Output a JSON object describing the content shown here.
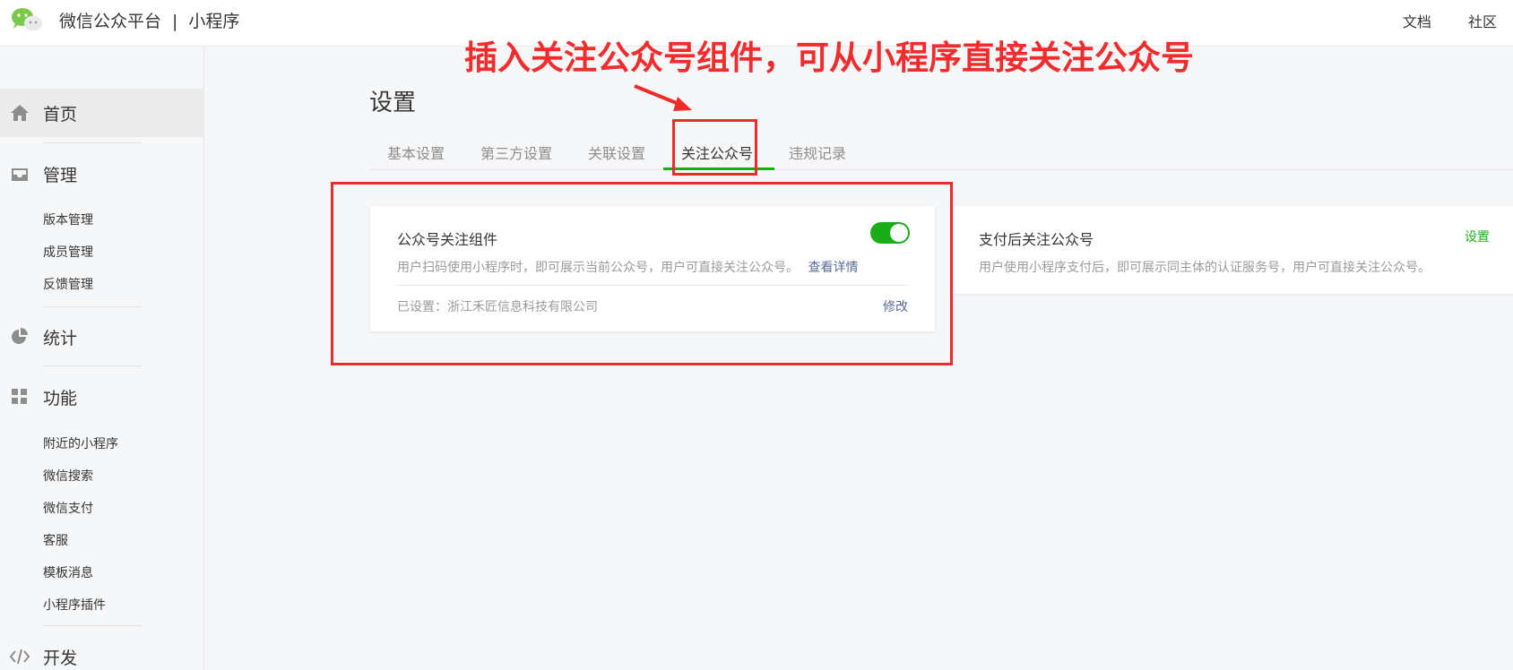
{
  "header": {
    "brand": "微信公众平台",
    "separator": "|",
    "product": "小程序",
    "links": [
      "文档",
      "社区"
    ]
  },
  "sidebar": {
    "sections": [
      {
        "label": "首页",
        "icon": "home-icon",
        "active": true
      },
      {
        "label": "管理",
        "icon": "inbox-icon",
        "items": [
          "版本管理",
          "成员管理",
          "反馈管理"
        ]
      },
      {
        "label": "统计",
        "icon": "pie-chart-icon"
      },
      {
        "label": "功能",
        "icon": "grid-icon",
        "items": [
          "附近的小程序",
          "微信搜索",
          "微信支付",
          "客服",
          "模板消息",
          "小程序插件"
        ]
      },
      {
        "label": "开发",
        "icon": "code-icon"
      }
    ]
  },
  "main": {
    "title": "设置",
    "tabs": [
      "基本设置",
      "第三方设置",
      "关联设置",
      "关注公众号",
      "违规记录"
    ],
    "active_tab": "关注公众号",
    "card1": {
      "title": "公众号关注组件",
      "toggle_on": true,
      "desc": "用户扫码使用小程序时，即可展示当前公众号，用户可直接关注公众号。",
      "detail_link": "查看详情",
      "status_label": "已设置：",
      "status_value": "浙江禾匠信息科技有限公司",
      "edit_link": "修改"
    },
    "card2": {
      "title": "支付后关注公众号",
      "setting_link": "设置",
      "desc": "用户使用小程序支付后，即可展示同主体的认证服务号，用户可直接关注公众号。"
    }
  },
  "annotation": {
    "text": "插入关注公众号组件，可从小程序直接关注公众号",
    "color": "#f12c2c"
  },
  "colors": {
    "accent_green": "#1aad19",
    "link_blue": "#576b95",
    "annotation_red": "#ee2b2b"
  }
}
